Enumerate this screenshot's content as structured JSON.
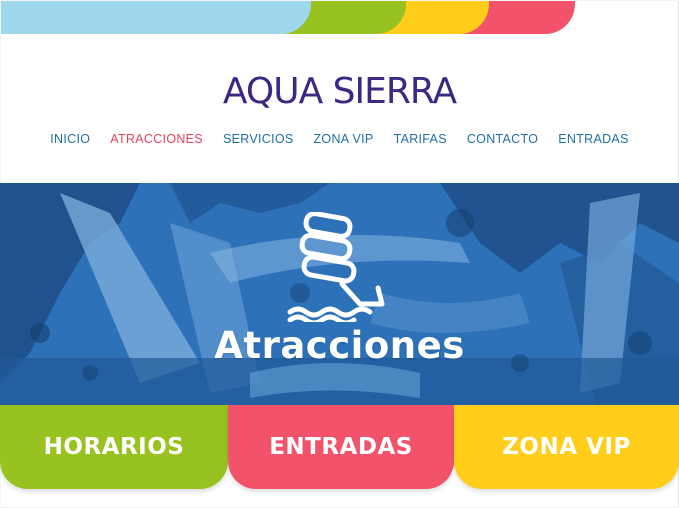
{
  "brand": {
    "logo_text": "AQUA SIERRA",
    "colors": {
      "blue": "#9fd7ec",
      "green": "#97c21f",
      "yellow": "#ffcd1a",
      "pink": "#f2536b",
      "navy": "#3c2783",
      "hero_blue": "#2b6fb6"
    }
  },
  "nav": {
    "items": [
      "INICIO",
      "ATRACCIONES",
      "SERVICIOS",
      "ZONA VIP",
      "TARIFAS",
      "CONTACTO",
      "ENTRADAS"
    ],
    "active": "ATRACCIONES"
  },
  "hero": {
    "icon": "water-slide-icon",
    "title": "Atracciones"
  },
  "cards": {
    "horarios": "HORARIOS",
    "entradas": "ENTRADAS",
    "zona_vip": "ZONA VIP"
  }
}
